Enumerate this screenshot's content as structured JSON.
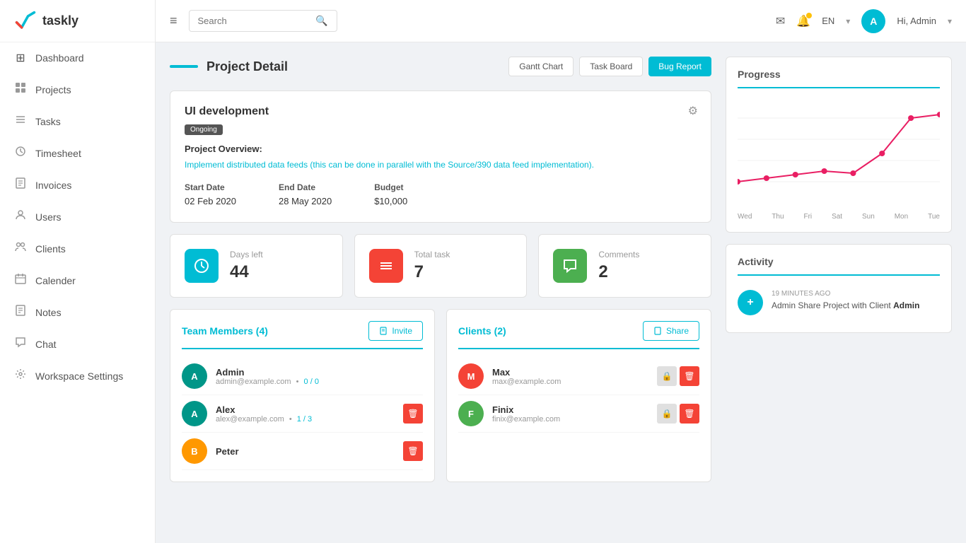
{
  "app": {
    "name": "taskly"
  },
  "sidebar": {
    "items": [
      {
        "id": "dashboard",
        "label": "Dashboard",
        "icon": "⊞"
      },
      {
        "id": "projects",
        "label": "Projects",
        "icon": "📁"
      },
      {
        "id": "tasks",
        "label": "Tasks",
        "icon": "☰"
      },
      {
        "id": "timesheet",
        "label": "Timesheet",
        "icon": "⏱"
      },
      {
        "id": "invoices",
        "label": "Invoices",
        "icon": "🖨"
      },
      {
        "id": "users",
        "label": "Users",
        "icon": "👤"
      },
      {
        "id": "clients",
        "label": "Clients",
        "icon": "👥"
      },
      {
        "id": "calender",
        "label": "Calender",
        "icon": "📅"
      },
      {
        "id": "notes",
        "label": "Notes",
        "icon": "📄"
      },
      {
        "id": "chat",
        "label": "Chat",
        "icon": "💬"
      },
      {
        "id": "workspace",
        "label": "Workspace Settings",
        "icon": "⚙"
      }
    ]
  },
  "topbar": {
    "search_placeholder": "Search",
    "lang": "EN",
    "user_initial": "A",
    "user_label": "Hi, Admin"
  },
  "page": {
    "title": "Project Detail",
    "buttons": {
      "gantt": "Gantt Chart",
      "board": "Task Board",
      "bug": "Bug Report"
    }
  },
  "project": {
    "name": "UI development",
    "status": "Ongoing",
    "overview_label": "Project Overview:",
    "overview_text": "Implement distributed data feeds (this can be done in parallel with the Source/390 data feed implementation).",
    "start_date_label": "Start Date",
    "start_date": "02 Feb 2020",
    "end_date_label": "End Date",
    "end_date": "28 May 2020",
    "budget_label": "Budget",
    "budget": "$10,000"
  },
  "stats": [
    {
      "id": "days",
      "label": "Days left",
      "value": "44",
      "color": "blue",
      "icon": "⏰"
    },
    {
      "id": "tasks",
      "label": "Total task",
      "value": "7",
      "color": "red",
      "icon": "≡"
    },
    {
      "id": "comments",
      "label": "Comments",
      "value": "2",
      "color": "green",
      "icon": "💬"
    }
  ],
  "team": {
    "title": "Team Members (4)",
    "invite_btn": "Invite",
    "members": [
      {
        "id": "admin",
        "name": "Admin",
        "email": "admin@example.com",
        "tasks": "0 / 0",
        "initial": "A",
        "color": "avatar-teal"
      },
      {
        "id": "alex",
        "name": "Alex",
        "email": "alex@example.com",
        "tasks": "1 / 3",
        "initial": "A",
        "color": "avatar-teal"
      },
      {
        "id": "peter",
        "name": "Peter",
        "email": "",
        "tasks": "",
        "initial": "B",
        "color": "avatar-orange"
      }
    ]
  },
  "clients": {
    "title": "Clients (2)",
    "share_btn": "Share",
    "items": [
      {
        "id": "max",
        "name": "Max",
        "email": "max@example.com",
        "initial": "M",
        "color": "avatar-red"
      },
      {
        "id": "finix",
        "name": "Finix",
        "email": "finix@example.com",
        "initial": "F",
        "color": "avatar-green"
      }
    ]
  },
  "progress": {
    "title": "Progress",
    "chart_labels": [
      "Wed",
      "Thu",
      "Fri",
      "Sat",
      "Sun",
      "Mon",
      "Tue"
    ]
  },
  "activity": {
    "title": "Activity",
    "items": [
      {
        "time": "19 MINUTES AGO",
        "text_before": "Admin Share Project with Client ",
        "text_bold": "Admin",
        "initial": "+"
      }
    ]
  }
}
